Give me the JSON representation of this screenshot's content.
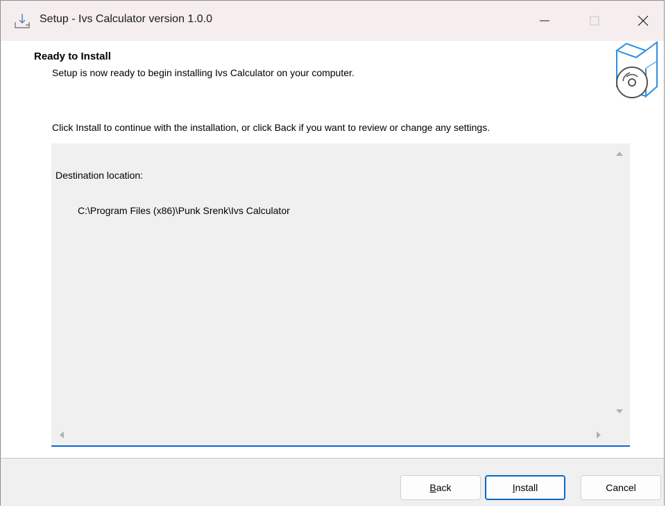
{
  "window": {
    "title": "Setup - Ivs Calculator version 1.0.0",
    "accent_color": "#0a64c8",
    "titlebar_color": "#f6eeee"
  },
  "header": {
    "title": "Ready to Install",
    "subtitle": "Setup is now ready to begin installing Ivs Calculator on your computer."
  },
  "main": {
    "instruction": "Click Install to continue with the installation, or click Back if you want to review or change any settings.",
    "memo": {
      "line1": "Destination location:",
      "line2": "C:\\Program Files (x86)\\Punk Srenk\\Ivs Calculator"
    }
  },
  "footer": {
    "back_first": "B",
    "back_rest": "ack",
    "install_first": "I",
    "install_rest": "nstall",
    "cancel_label": "Cancel"
  },
  "icons": {
    "app": "installer-download-icon",
    "wizard": "software-box-cd-icon",
    "minimize": "minimize-icon",
    "maximize": "maximize-icon",
    "close": "close-icon"
  }
}
